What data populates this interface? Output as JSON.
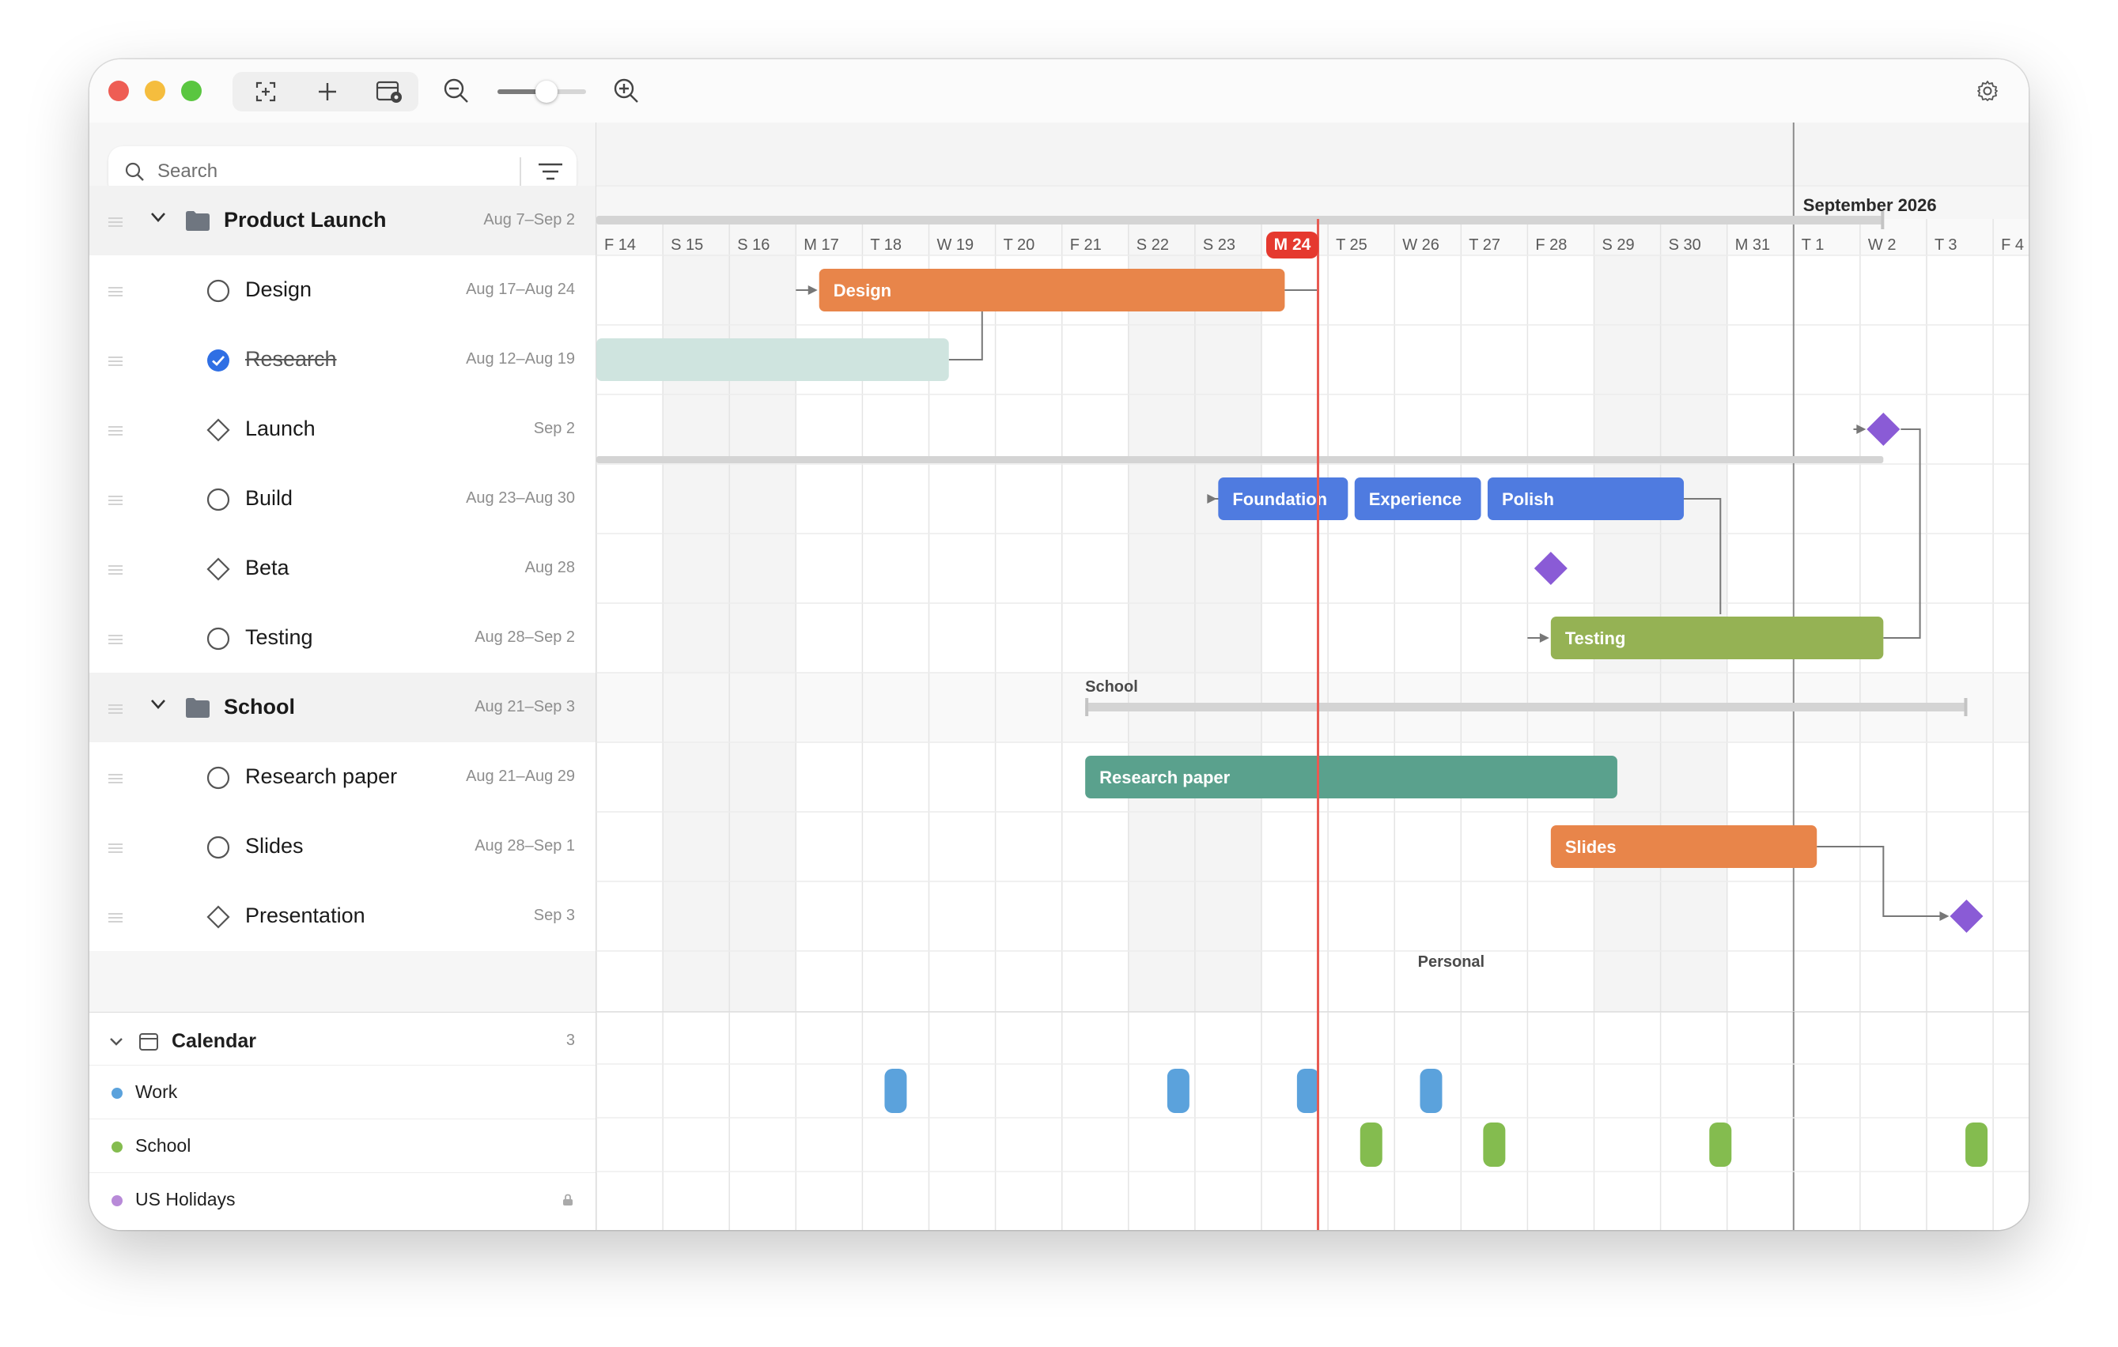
{
  "toolbar": {
    "zoom_level": 0.55
  },
  "sidebar": {
    "search_placeholder": "Search",
    "rows": [
      {
        "kind": "group",
        "title": "Product Launch",
        "dates": "Aug 7–Sep 2"
      },
      {
        "kind": "task",
        "status": "open",
        "title": "Design",
        "dates": "Aug 17–Aug 24"
      },
      {
        "kind": "task",
        "status": "done",
        "title": "Research",
        "dates": "Aug 12–Aug 19"
      },
      {
        "kind": "milestone",
        "status": "milestone",
        "title": "Launch",
        "dates": "Sep 2"
      },
      {
        "kind": "task",
        "status": "open",
        "title": "Build",
        "dates": "Aug 23–Aug 30"
      },
      {
        "kind": "milestone",
        "status": "milestone",
        "title": "Beta",
        "dates": "Aug 28"
      },
      {
        "kind": "task",
        "status": "open",
        "title": "Testing",
        "dates": "Aug 28–Sep 2"
      },
      {
        "kind": "group",
        "title": "School",
        "dates": "Aug 21–Sep 3"
      },
      {
        "kind": "task",
        "status": "open",
        "title": "Research paper",
        "dates": "Aug 21–Aug 29"
      },
      {
        "kind": "task",
        "status": "open",
        "title": "Slides",
        "dates": "Aug 28–Sep 1"
      },
      {
        "kind": "milestone",
        "status": "milestone",
        "title": "Presentation",
        "dates": "Sep 3"
      }
    ]
  },
  "calendar": {
    "title": "Calendar",
    "count": "3",
    "items": [
      {
        "name": "Work",
        "color": "#5ba2dc"
      },
      {
        "name": "School",
        "color": "#84bc4f"
      },
      {
        "name": "US Holidays",
        "color": "#b88ad8",
        "locked": true
      }
    ]
  },
  "timeline": {
    "month_label": "September 2026",
    "days": [
      "F 14",
      "S 15",
      "S 16",
      "M 17",
      "T 18",
      "W 19",
      "T 20",
      "F 21",
      "S 22",
      "S 23",
      "M 24",
      "T 25",
      "W 26",
      "T 27",
      "F 28",
      "S 29",
      "S 30",
      "M 31",
      "T 1",
      "W 2",
      "T 3",
      "F 4"
    ],
    "today_index": 10,
    "weekend_indices": [
      1,
      2,
      8,
      9,
      15,
      16
    ],
    "month_boundary_index": 18,
    "group_labels": {
      "school": "School",
      "personal": "Personal"
    },
    "bars": [
      {
        "label": "Design",
        "row": 1,
        "start": 3.35,
        "end": 10.35,
        "color": "#e8854a"
      },
      {
        "label": "",
        "row": 2,
        "start": 0,
        "end": 5.3,
        "color": "#cfe4df"
      },
      {
        "label": "Foundation",
        "row": 4,
        "start": 9.35,
        "end": 11.3,
        "color": "#4f7be0"
      },
      {
        "label": "Experience",
        "row": 4,
        "start": 11.4,
        "end": 13.3,
        "color": "#4f7be0"
      },
      {
        "label": "Polish",
        "row": 4,
        "start": 13.4,
        "end": 16.35,
        "color": "#4f7be0"
      },
      {
        "label": "Testing",
        "row": 6,
        "start": 14.35,
        "end": 19.35,
        "color": "#95b254"
      },
      {
        "label": "Research paper",
        "row": 8,
        "start": 7.35,
        "end": 15.35,
        "color": "#5aa18d"
      },
      {
        "label": "Slides",
        "row": 9,
        "start": 14.35,
        "end": 18.35,
        "color": "#e8854a"
      }
    ],
    "milestones": [
      {
        "row": 3,
        "day": 19.35,
        "color": "#8a5bd6"
      },
      {
        "row": 5,
        "day": 14.35,
        "color": "#8a5bd6"
      },
      {
        "row": 10,
        "day": 20.6,
        "color": "#8a5bd6"
      }
    ],
    "calendar_events": [
      {
        "calendar": "Work",
        "day": 4.5
      },
      {
        "calendar": "Work",
        "day": 8.75
      },
      {
        "calendar": "Work",
        "day": 10.7
      },
      {
        "calendar": "Work",
        "day": 12.55
      },
      {
        "calendar": "School",
        "day": 11.65
      },
      {
        "calendar": "School",
        "day": 13.5
      },
      {
        "calendar": "School",
        "day": 16.9
      },
      {
        "calendar": "School",
        "day": 20.75
      }
    ]
  },
  "colors": {
    "accent": "#2f6fe4",
    "today": "#e5392f",
    "milestone": "#8a5bd6"
  }
}
